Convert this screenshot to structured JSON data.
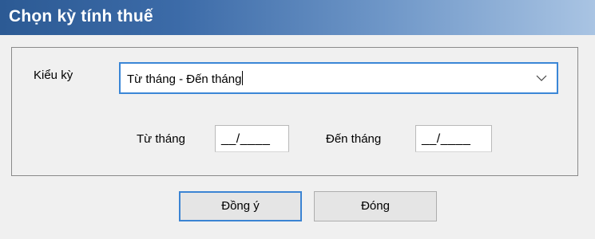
{
  "dialog": {
    "title": "Chọn kỳ tính thuế"
  },
  "period": {
    "type_label": "Kiểu kỳ",
    "type_value": "Từ tháng - Đến tháng",
    "dropdown_icon": "chevron-down-icon"
  },
  "range": {
    "from_label": "Từ tháng",
    "from_value": "__/____",
    "to_label": "Đến tháng",
    "to_value": "__/____"
  },
  "buttons": {
    "ok_label": "Đồng ý",
    "close_label": "Đóng"
  },
  "colors": {
    "title_start": "#2c5a94",
    "title_end": "#a9c4e3",
    "focus_border": "#3a86d6",
    "window_bg": "#f0f0f0"
  }
}
